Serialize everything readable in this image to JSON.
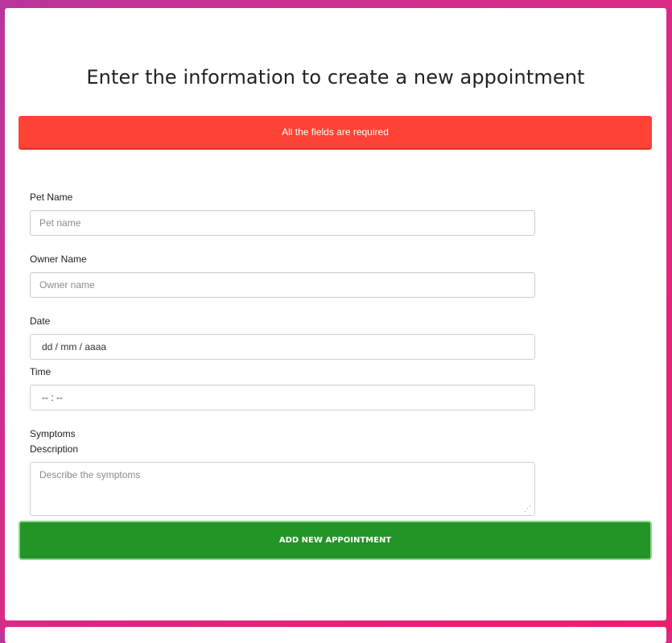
{
  "form": {
    "title": "Enter the information to create a new appointment",
    "alert": "All the fields are required",
    "pet_name": {
      "label": "Pet Name",
      "placeholder": "Pet name"
    },
    "owner_name": {
      "label": "Owner Name",
      "placeholder": "Owner name"
    },
    "date": {
      "label": "Date",
      "value": "dd / mm / aaaa"
    },
    "time": {
      "label": "Time",
      "value": "-- : --"
    },
    "symptoms": {
      "label_line1": "Symptoms",
      "label_line2": "Description",
      "placeholder": "Describe the symptoms"
    },
    "submit_label": "ADD NEW APPOINTMENT"
  },
  "colors": {
    "alert": "#ff4236",
    "button": "#229526",
    "background_gradient_start": "#b8359a",
    "background_gradient_end": "#e81f6e"
  }
}
